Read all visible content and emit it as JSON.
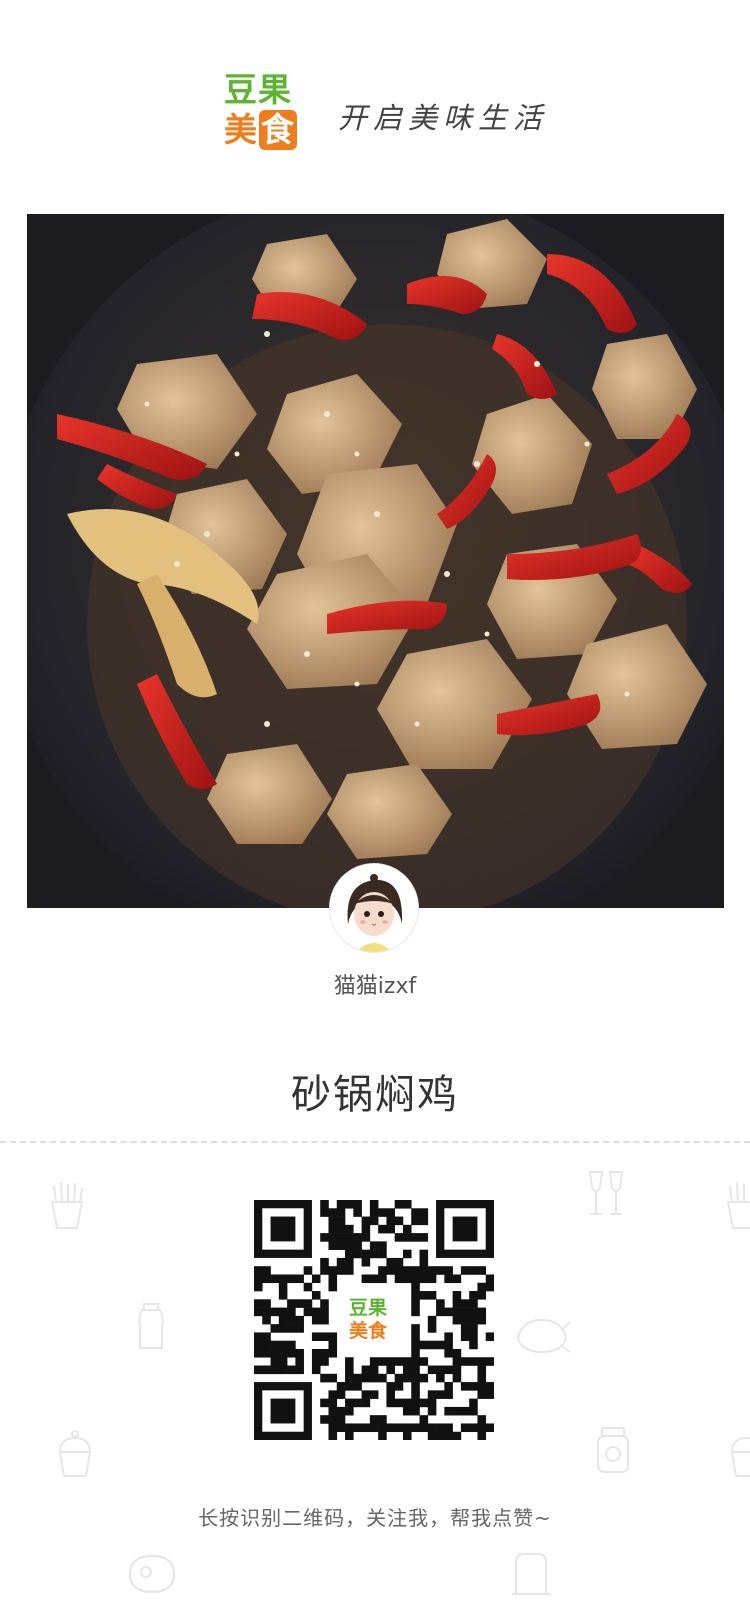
{
  "brand": {
    "logo_top": "豆果",
    "logo_bottom_a": "美",
    "logo_bottom_b": "食",
    "slogan": "开启美味生活",
    "green": "#5cb531",
    "orange": "#f07d1b"
  },
  "photo": {
    "subject": "food-photo"
  },
  "author": {
    "name": "猫猫izxf"
  },
  "recipe": {
    "title": "砂锅焖鸡"
  },
  "qr": {
    "logo_top": "豆果",
    "logo_bottom": "美食"
  },
  "caption": "长按识别二维码，关注我，帮我点赞~",
  "background_icons": [
    "fries-icon",
    "wine-glasses-icon",
    "salt-shaker-icon",
    "roast-chicken-icon",
    "cupcake-icon",
    "jar-icon",
    "steak-icon",
    "toaster-icon"
  ]
}
